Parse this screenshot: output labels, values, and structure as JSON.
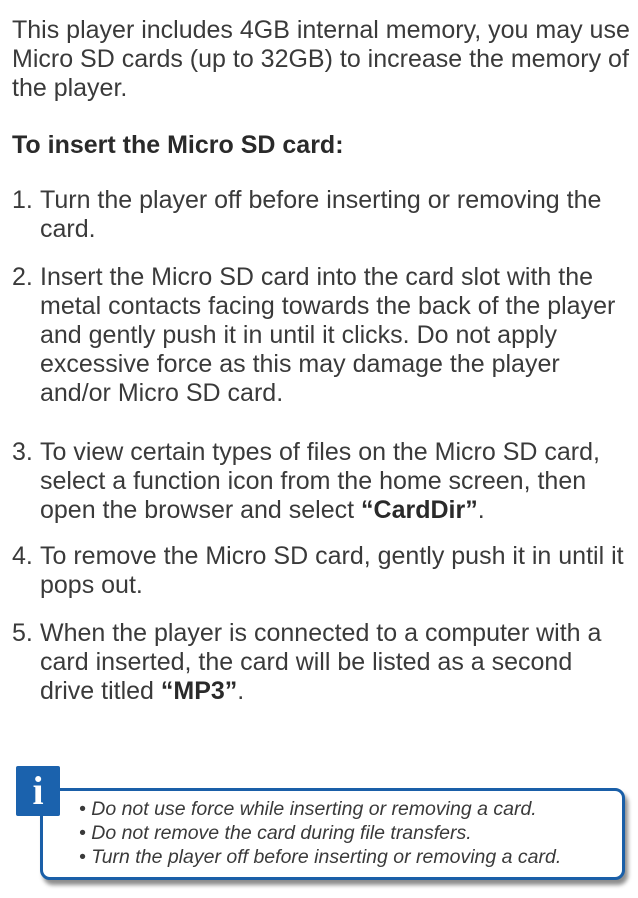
{
  "intro": "This player includes 4GB internal memory, you may use Micro SD cards (up to 32GB) to increase the memory of the player.",
  "heading": "To insert the Micro SD card:",
  "steps": [
    {
      "num": "1.",
      "text": "Turn the player off before inserting or removing the card."
    },
    {
      "num": "2.",
      "text": "Insert the Micro SD card into the card slot with the metal contacts facing towards the back of the player and gently push it in until it clicks.  Do not apply excessive force as this may damage the player and/or Micro SD card."
    },
    {
      "num": "3.",
      "text": "To view certain types of files on the Micro SD card, select a function icon from the home screen, then open the browser and select ",
      "bold": "“CardDir”",
      "after": "."
    },
    {
      "num": "4.",
      "text": "To remove the Micro SD card, gently push it in until it pops out."
    },
    {
      "num": "5.",
      "text": "When the player is connected to a computer with a card inserted, the card will be listed as a second drive titled ",
      "bold": "“MP3”",
      "after": "."
    }
  ],
  "note": {
    "icon": "i",
    "icon_name": "info-icon",
    "accent_color": "#1b62ad",
    "items": [
      "• Do not use force while inserting or removing a card.",
      "• Do not remove the card during file transfers.",
      "• Turn the player off before inserting or removing a card."
    ]
  }
}
